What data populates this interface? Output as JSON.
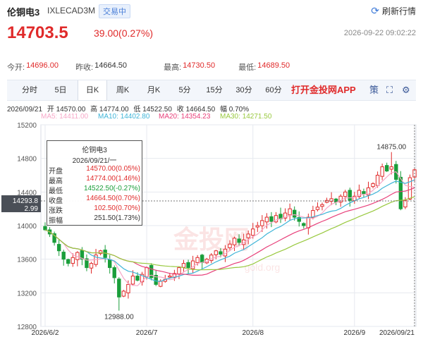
{
  "header": {
    "name": "伦铜电3",
    "code": "IXLECAD3M",
    "status_badge": "交易中",
    "refresh_label": "刷新行情",
    "price": "14703.5",
    "change": "39.00(0.27%)",
    "timestamp": "2026-09-22 09:02:22"
  },
  "quote": {
    "open_label": "今开:",
    "open_value": "14696.00",
    "prev_close_label": "昨收:",
    "prev_close_value": "14664.50",
    "high_label": "最高:",
    "high_value": "14730.50",
    "low_label": "最低:",
    "low_value": "14689.50"
  },
  "tabs": [
    {
      "label": "分时"
    },
    {
      "label": "5日"
    },
    {
      "label": "日K"
    },
    {
      "label": "周K"
    },
    {
      "label": "月K"
    },
    {
      "label": "5分"
    },
    {
      "label": "15分"
    },
    {
      "label": "30分"
    },
    {
      "label": "60分"
    }
  ],
  "active_tab": "日K",
  "promo_text": "打开金投网APP",
  "toolbar": {
    "strategy_label": "策"
  },
  "bar_info": {
    "date": "2026/09/21",
    "open_label": "开",
    "open": "14570.00",
    "high_label": "高",
    "high": "14774.00",
    "low_label": "低",
    "low": "14522.50",
    "close_label": "收",
    "close": "14664.50",
    "change_label": "幅",
    "change_pct": "0.70%"
  },
  "ma_legend": [
    {
      "label": "MA5: ",
      "value": "14411.00",
      "color": "#f7a8c8"
    },
    {
      "label": "MA10: ",
      "value": "14402.80",
      "color": "#3fb5d8"
    },
    {
      "label": "MA20: ",
      "value": "14354.23",
      "color": "#e8417b"
    },
    {
      "label": "MA30: ",
      "value": "14271.50",
      "color": "#99c93f"
    }
  ],
  "tooltip": {
    "title": "伦铜电3",
    "date": "2026/09/21/一",
    "rows": [
      {
        "label": "开盘",
        "value": "14570.00(0.05%)",
        "color": "#e02a2a"
      },
      {
        "label": "最高",
        "value": "14774.00(1.46%)",
        "color": "#e02a2a"
      },
      {
        "label": "最低",
        "value": "14522.50(-0.27%)",
        "color": "#1a9e3a"
      },
      {
        "label": "收盘",
        "value": "14664.50(0.70%)",
        "color": "#e02a2a"
      },
      {
        "label": "涨跌",
        "value": "102.50(0.70%)",
        "color": "#e02a2a"
      },
      {
        "label": "振幅",
        "value": "251.50(1.73%)",
        "color": "#333333"
      }
    ]
  },
  "cursor_label": {
    "price": "14293.8",
    "pct": "2.99"
  },
  "watermark": {
    "text": "金投网",
    "url": "gold.org"
  },
  "chart_data": {
    "type": "candlestick",
    "ylim": [
      12800,
      15200
    ],
    "y_ticks": [
      15200,
      14800,
      14400,
      14000,
      13600,
      13200,
      12800
    ],
    "y_tick_labels": [
      "15200",
      "14800",
      "14400",
      "14000",
      "13600",
      "13200",
      "12800"
    ],
    "x_tick_labels": [
      "2026/6/2",
      "2026/7",
      "2026/8",
      "2026/9",
      "2026/09/21"
    ],
    "x_tick_index": [
      0,
      22,
      45,
      67,
      80
    ],
    "n_bars": 81,
    "annotations": [
      {
        "text": "14875.00",
        "index": 75,
        "value": 14875
      },
      {
        "text": "12988.00",
        "index": 16,
        "value": 12988
      }
    ],
    "closes": [
      13950,
      13900,
      13800,
      13700,
      13600,
      13550,
      13620,
      13680,
      13600,
      13500,
      13550,
      13650,
      13700,
      13620,
      13500,
      13380,
      13150,
      13220,
      13300,
      13400,
      13350,
      13420,
      13500,
      13380,
      13300,
      13340,
      13360,
      13400,
      13430,
      13500,
      13550,
      13500,
      13580,
      13620,
      13560,
      13600,
      13650,
      13700,
      13660,
      13720,
      13780,
      13850,
      13800,
      13830,
      13900,
      13960,
      14000,
      14060,
      14100,
      14050,
      14120,
      14080,
      14150,
      14200,
      14100,
      14050,
      14000,
      14100,
      14180,
      14220,
      14250,
      14300,
      14320,
      14280,
      14350,
      14400,
      14300,
      14350,
      14420,
      14380,
      14450,
      14500,
      14600,
      14700,
      14650,
      14700,
      14550,
      14200,
      14300,
      14570,
      14664.5
    ],
    "series": [
      {
        "name": "MA5",
        "color": "#f7a8c8"
      },
      {
        "name": "MA10",
        "color": "#3fb5d8"
      },
      {
        "name": "MA20",
        "color": "#e8417b"
      },
      {
        "name": "MA30",
        "color": "#99c93f"
      }
    ]
  }
}
